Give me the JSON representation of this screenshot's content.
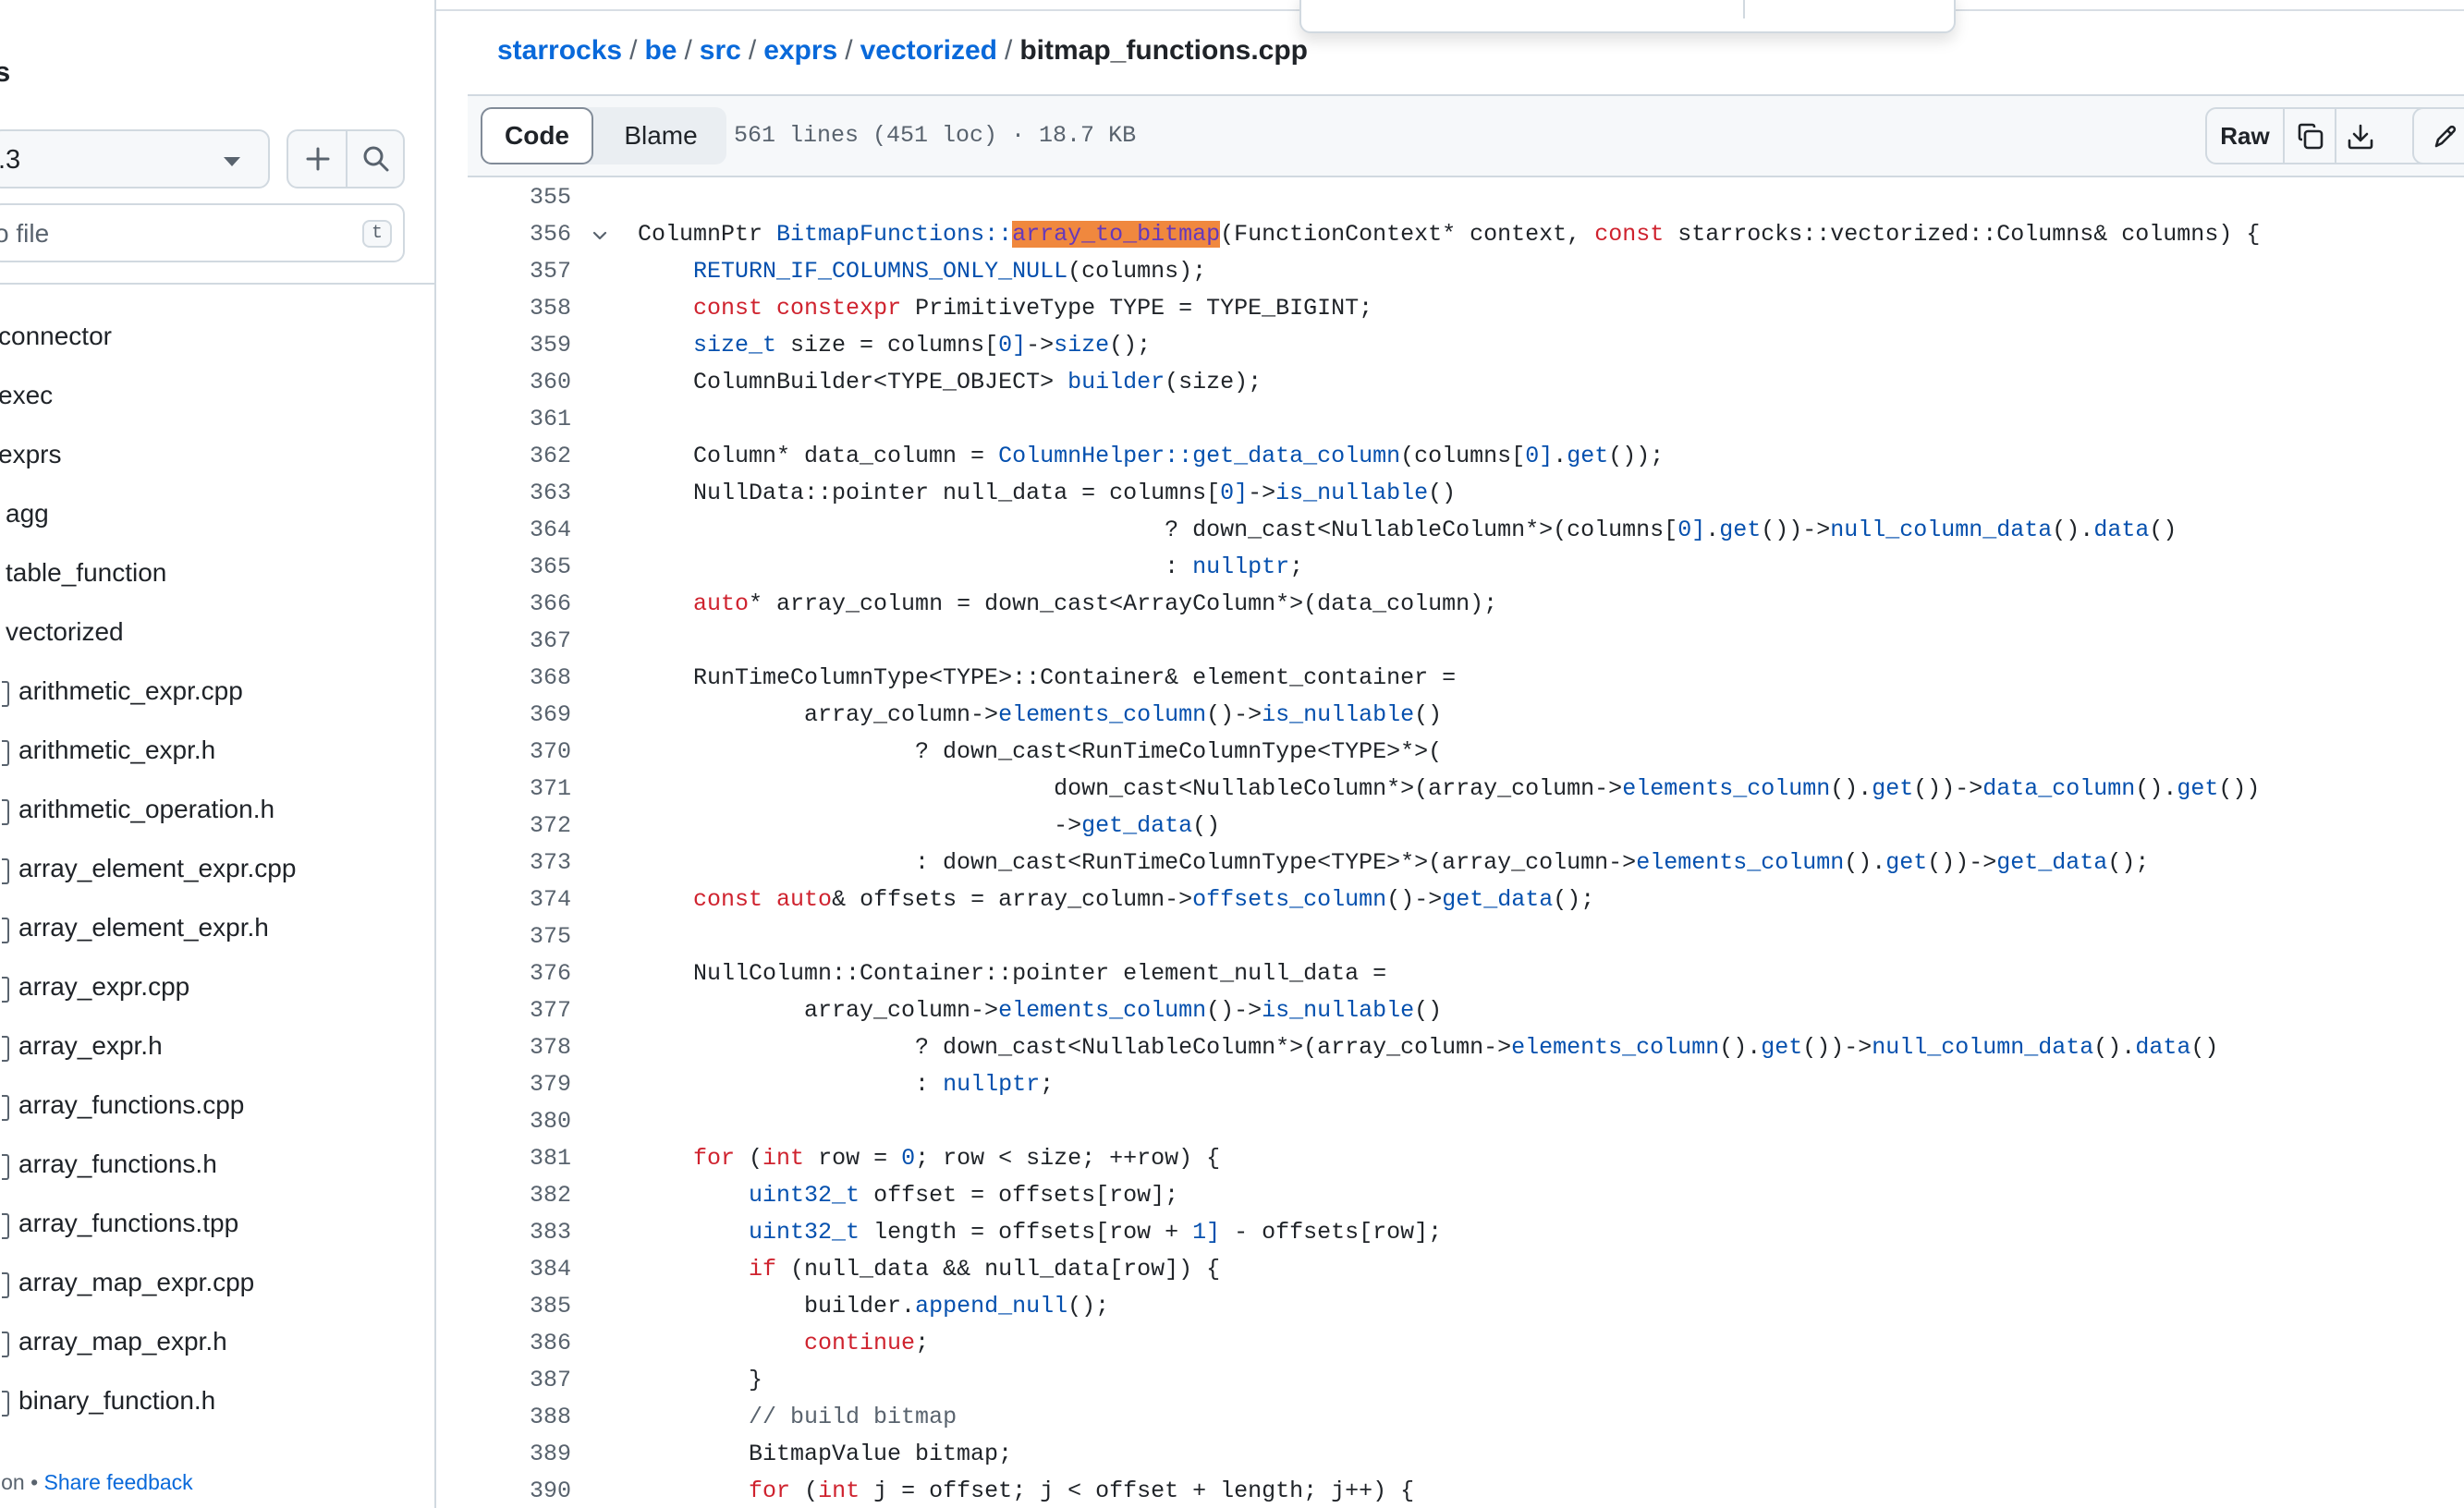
{
  "sidebar": {
    "title": "s",
    "branch": ".3",
    "search_placeholder": "o file",
    "search_shortcut": "t",
    "tree": [
      {
        "label": "connector",
        "type": "dir"
      },
      {
        "label": "exec",
        "type": "dir"
      },
      {
        "label": "exprs",
        "type": "dir"
      },
      {
        "label": "agg",
        "type": "dir"
      },
      {
        "label": "table_function",
        "type": "dir"
      },
      {
        "label": "vectorized",
        "type": "dir"
      },
      {
        "label": "arithmetic_expr.cpp",
        "type": "file"
      },
      {
        "label": "arithmetic_expr.h",
        "type": "file"
      },
      {
        "label": "arithmetic_operation.h",
        "type": "file"
      },
      {
        "label": "array_element_expr.cpp",
        "type": "file"
      },
      {
        "label": "array_element_expr.h",
        "type": "file"
      },
      {
        "label": "array_expr.cpp",
        "type": "file"
      },
      {
        "label": "array_expr.h",
        "type": "file"
      },
      {
        "label": "array_functions.cpp",
        "type": "file"
      },
      {
        "label": "array_functions.h",
        "type": "file"
      },
      {
        "label": "array_functions.tpp",
        "type": "file"
      },
      {
        "label": "array_map_expr.cpp",
        "type": "file"
      },
      {
        "label": "array_map_expr.h",
        "type": "file"
      },
      {
        "label": "binary_function.h",
        "type": "file"
      }
    ],
    "footer_left": "ion",
    "footer_sep": "•",
    "footer_link": "Share feedback"
  },
  "breadcrumb": {
    "parts": [
      "starrocks",
      "be",
      "src",
      "exprs",
      "vectorized"
    ],
    "current": "bitmap_functions.cpp"
  },
  "file_header": {
    "tab_code": "Code",
    "tab_blame": "Blame",
    "meta": "561 lines (451 loc) · 18.7 KB",
    "raw": "Raw"
  },
  "code_lines": [
    {
      "n": "355",
      "t": ""
    },
    {
      "n": "356",
      "fold": true,
      "t": "ColumnPtr [[fn:BitmapFunctions::]][[hl:array_to_bitmap]](FunctionContext* context, [[kw:const]] starrocks::vectorized::Columns& columns) {"
    },
    {
      "n": "357",
      "t": "    [[fn:RETURN_IF_COLUMNS_ONLY_NULL]](columns);"
    },
    {
      "n": "358",
      "t": "    [[kw:const]] [[kw:constexpr]] PrimitiveType TYPE = TYPE_BIGINT;"
    },
    {
      "n": "359",
      "t": "    [[fn:size_t]] size = columns[[[fn:0]]]->[[fn:size]]();"
    },
    {
      "n": "360",
      "t": "    ColumnBuilder<TYPE_OBJECT> [[fn:builder]](size);"
    },
    {
      "n": "361",
      "t": ""
    },
    {
      "n": "362",
      "t": "    Column* data_column = [[fn:ColumnHelper::get_data_column]](columns[[[fn:0]]].[[fn:get]]());"
    },
    {
      "n": "363",
      "t": "    NullData::pointer null_data = columns[[[fn:0]]]->[[fn:is_nullable]]()"
    },
    {
      "n": "364",
      "t": "                                      ? down_cast<NullableColumn*>(columns[[[fn:0]]].[[fn:get]]())->[[fn:null_column_data]]().[[fn:data]]()"
    },
    {
      "n": "365",
      "t": "                                      : [[fn:nullptr]];"
    },
    {
      "n": "366",
      "t": "    [[kw:auto]]* array_column = down_cast<ArrayColumn*>(data_column);"
    },
    {
      "n": "367",
      "t": ""
    },
    {
      "n": "368",
      "t": "    RunTimeColumnType<TYPE>::Container& element_container ="
    },
    {
      "n": "369",
      "t": "            array_column->[[fn:elements_column]]()->[[fn:is_nullable]]()"
    },
    {
      "n": "370",
      "t": "                    ? down_cast<RunTimeColumnType<TYPE>*>("
    },
    {
      "n": "371",
      "t": "                              down_cast<NullableColumn*>(array_column->[[fn:elements_column]]().[[fn:get]]())->[[fn:data_column]]().[[fn:get]]())"
    },
    {
      "n": "372",
      "t": "                              ->[[fn:get_data]]()"
    },
    {
      "n": "373",
      "t": "                    : down_cast<RunTimeColumnType<TYPE>*>(array_column->[[fn:elements_column]]().[[fn:get]]())->[[fn:get_data]]();"
    },
    {
      "n": "374",
      "t": "    [[kw:const]] [[kw:auto]]& offsets = array_column->[[fn:offsets_column]]()->[[fn:get_data]]();"
    },
    {
      "n": "375",
      "t": ""
    },
    {
      "n": "376",
      "t": "    NullColumn::Container::pointer element_null_data ="
    },
    {
      "n": "377",
      "t": "            array_column->[[fn:elements_column]]()->[[fn:is_nullable]]()"
    },
    {
      "n": "378",
      "t": "                    ? down_cast<NullableColumn*>(array_column->[[fn:elements_column]]().[[fn:get]]())->[[fn:null_column_data]]().[[fn:data]]()"
    },
    {
      "n": "379",
      "t": "                    : [[fn:nullptr]];"
    },
    {
      "n": "380",
      "t": ""
    },
    {
      "n": "381",
      "t": "    [[kw:for]] ([[kw:int]] row = [[fn:0]]; row < size; ++row) {"
    },
    {
      "n": "382",
      "t": "        [[fn:uint32_t]] offset = offsets[row];"
    },
    {
      "n": "383",
      "t": "        [[fn:uint32_t]] length = offsets[row + [[fn:1]]] - offsets[row];"
    },
    {
      "n": "384",
      "t": "        [[kw:if]] (null_data && null_data[row]) {"
    },
    {
      "n": "385",
      "t": "            builder.[[fn:append_null]]();"
    },
    {
      "n": "386",
      "t": "            [[kw:continue]];"
    },
    {
      "n": "387",
      "t": "        }"
    },
    {
      "n": "388",
      "t": "        [[cm:// build bitmap]]"
    },
    {
      "n": "389",
      "t": "        BitmapValue bitmap;"
    },
    {
      "n": "390",
      "t": "        [[kw:for]] ([[kw:int]] j = offset; j < offset + length; j++) {"
    }
  ]
}
